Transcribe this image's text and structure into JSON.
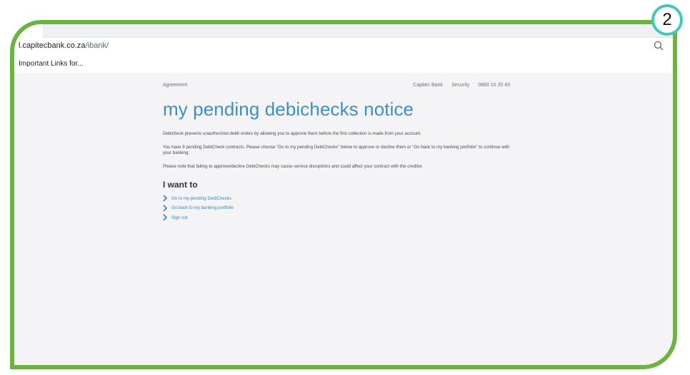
{
  "browser": {
    "url_host": "l.capitecbank.co.za",
    "url_path": "/ibank/",
    "bookmark": "Important Links for..."
  },
  "nav": {
    "left": "Agreement",
    "right": [
      "Capitec Bank",
      "Security",
      "0860 10 20 43"
    ]
  },
  "page": {
    "title": "my pending debichecks notice",
    "paragraphs": [
      "Debicheck prevents unauthorized debit orders by allowing you to approve them before the first collection is made from your account.",
      "You have 9 pending DebiCheck contracts. Please choose \"Go to my pending DebiChecks\" below to approve or decline them or \"Go back to my banking portfolio\" to continue with your banking.",
      "Please note that failing to approve/decline DebiChecks may cause service disruptions and could affect your contract with the creditor."
    ],
    "section_title": "I want to",
    "links": [
      "Go to my pending DebiChecks",
      "Go back to my banking portfolio",
      "Sign out"
    ]
  },
  "annotation": {
    "step": "2"
  },
  "colors": {
    "frame": "#6db33f",
    "badge_ring": "#40c8b8",
    "title": "#3d8fbd",
    "link": "#2f86b6"
  }
}
